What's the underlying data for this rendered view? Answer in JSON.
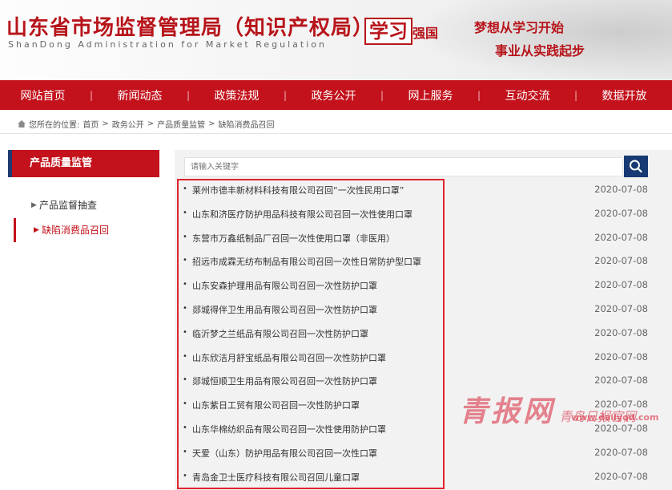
{
  "header": {
    "title": "山东省市场监督管理局（知识产权局）",
    "subtitle": "ShanDong Administration for Market Regulation",
    "logo_big": "学习",
    "logo_small": "强国",
    "slogan_line1": "梦想从学习开始",
    "slogan_line2": "事业从实践起步"
  },
  "nav": {
    "items": [
      "网站首页",
      "新闻动态",
      "政策法规",
      "政务公开",
      "网上服务",
      "互动交流",
      "数据开放"
    ],
    "separator": "|"
  },
  "breadcrumb": {
    "prefix": "您所在的位置:",
    "items": [
      "首页",
      "政务公开",
      "产品质量监管",
      "缺陷消费品召回"
    ],
    "separator": ">"
  },
  "sidebar": {
    "heading": "产品质量监管",
    "items": [
      {
        "label": "产品监督抽查",
        "active": false
      },
      {
        "label": "缺陷消费品召回",
        "active": true
      }
    ]
  },
  "search": {
    "placeholder": "请输入关键字",
    "icon": "search-icon"
  },
  "list": {
    "bullet": "•",
    "rows": [
      {
        "title": "莱州市德丰新材料科技有限公司召回“一次性民用口罩”",
        "date": "2020-07-08"
      },
      {
        "title": "山东和济医疗防护用品科技有限公司召回一次性使用口罩",
        "date": "2020-07-08"
      },
      {
        "title": "东营市万鑫纸制品厂召回一次性使用口罩（非医用）",
        "date": "2020-07-08"
      },
      {
        "title": "招远市成霖无纺布制品有限公司召回一次性日常防护型口罩",
        "date": "2020-07-08"
      },
      {
        "title": "山东安森护理用品有限公司召回一次性防护口罩",
        "date": "2020-07-08"
      },
      {
        "title": "郯城得伴卫生用品有限公司召回一次性防护口罩",
        "date": "2020-07-08"
      },
      {
        "title": "临沂梦之兰纸品有限公司召回一次性防护口罩",
        "date": "2020-07-08"
      },
      {
        "title": "山东欣洁月舒宝纸品有限公司召回一次性防护口罩",
        "date": "2020-07-08"
      },
      {
        "title": "郯城恒顺卫生用品有限公司召回一次性防护口罩",
        "date": "2020-07-08"
      },
      {
        "title": "山东紫日工贸有限公司召回一次性防护口罩",
        "date": "2020-07-08"
      },
      {
        "title": "山东华棉纺织品有限公司召回一次性使用防护口罩",
        "date": "2020-07-08"
      },
      {
        "title": "天爱（山东）防护用品有限公司召回一次性口罩",
        "date": "2020-07-08"
      },
      {
        "title": "青岛金卫士医疗科技有限公司召回儿童口罩",
        "date": "2020-07-08"
      }
    ]
  },
  "watermark": {
    "main": "青报网",
    "sub": "青岛日报官网",
    "url": "www.dailyqd.com"
  },
  "colors": {
    "brand_red": "#c3121c",
    "nav_blue": "#1f3b73",
    "highlight_border": "#e0242e"
  }
}
